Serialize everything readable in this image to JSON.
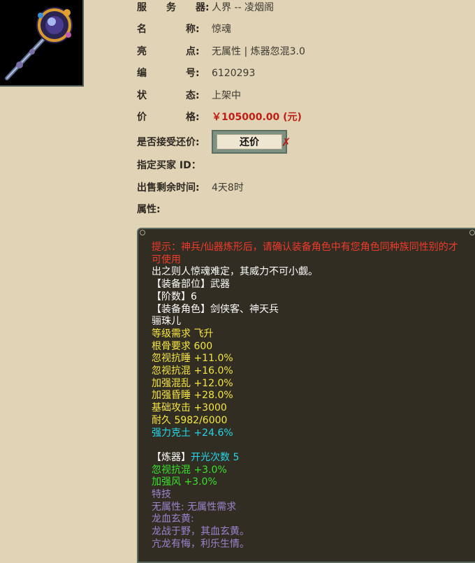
{
  "item": {
    "image_icon": "staff-weapon-icon"
  },
  "fields": [
    {
      "label": "服　　务　　器:",
      "value": "人界 -- 凌烟阁"
    },
    {
      "label": "名　　　　称:",
      "value": "惊魂"
    },
    {
      "label": "亮　　　　点:",
      "value": "无属性 | 炼器忽混3.0"
    },
    {
      "label": "编　　　　号:",
      "value": "6120293"
    },
    {
      "label": "状　　　　态:",
      "value": "上架中"
    },
    {
      "label": "价　　　　格:",
      "value": "￥105000.00 (元)"
    }
  ],
  "bargain": {
    "label": "是否接受还价:",
    "button_label": "还价",
    "ribbon_icon": "ribbon-icon"
  },
  "buyer": {
    "label": "指定买家 ID："
  },
  "remaining": {
    "label": "出售剩余时间:",
    "value": "4天8时"
  },
  "attributes": {
    "label": "属性:"
  },
  "colors": {
    "background": "#e1d3b6",
    "panel": "#312d23",
    "price": "#c01e14",
    "hint_red": "#f03a2c",
    "yellow": "#f7e642",
    "cyan": "#24d7e9",
    "green": "#39e12b",
    "purple": "#9a84ce"
  },
  "panel_lines": [
    {
      "text": "提示：神兵/仙器炼形后，请确认装备角色中有您角色同种族同性别的才可使用",
      "color": "red"
    },
    {
      "text": "出之则人惊魂难定，其威力不可小觑。",
      "color": "white"
    },
    {
      "text": "【装备部位】武器",
      "color": "white"
    },
    {
      "text": "【阶数】6",
      "color": "white"
    },
    {
      "text": "【装备角色】剑侠客、神天兵",
      "color": "white"
    },
    {
      "text": "骊珠儿",
      "color": "white"
    },
    {
      "text": "等级需求 飞升",
      "color": "yellow"
    },
    {
      "text": "根骨要求 600",
      "color": "yellow"
    },
    {
      "text": "忽视抗睡 +11.0%",
      "color": "yellow"
    },
    {
      "text": "忽视抗混 +16.0%",
      "color": "yellow"
    },
    {
      "text": "加强混乱 +12.0%",
      "color": "yellow"
    },
    {
      "text": "加强昏睡 +28.0%",
      "color": "yellow"
    },
    {
      "text": "基础攻击 +3000",
      "color": "yellow"
    },
    {
      "text": "耐久 5982/6000",
      "color": "yellow"
    },
    {
      "text": "强力克土 +24.6%",
      "color": "cyan"
    },
    {
      "text": "",
      "color": "white"
    },
    {
      "prefix": "【炼器】",
      "text": "开光次数 5",
      "color": "cyan"
    },
    {
      "text": "忽视抗混 +3.0%",
      "color": "green"
    },
    {
      "text": "加强风 +3.0%",
      "color": "green"
    },
    {
      "text": "特技",
      "color": "purple"
    },
    {
      "text": "无属性: 无属性需求",
      "color": "purple"
    },
    {
      "text": "龙血玄黄:",
      "color": "purple"
    },
    {
      "text": "龙战于野，其血玄黄。",
      "color": "purple"
    },
    {
      "text": "亢龙有悔，利乐生情。",
      "color": "purple"
    }
  ]
}
